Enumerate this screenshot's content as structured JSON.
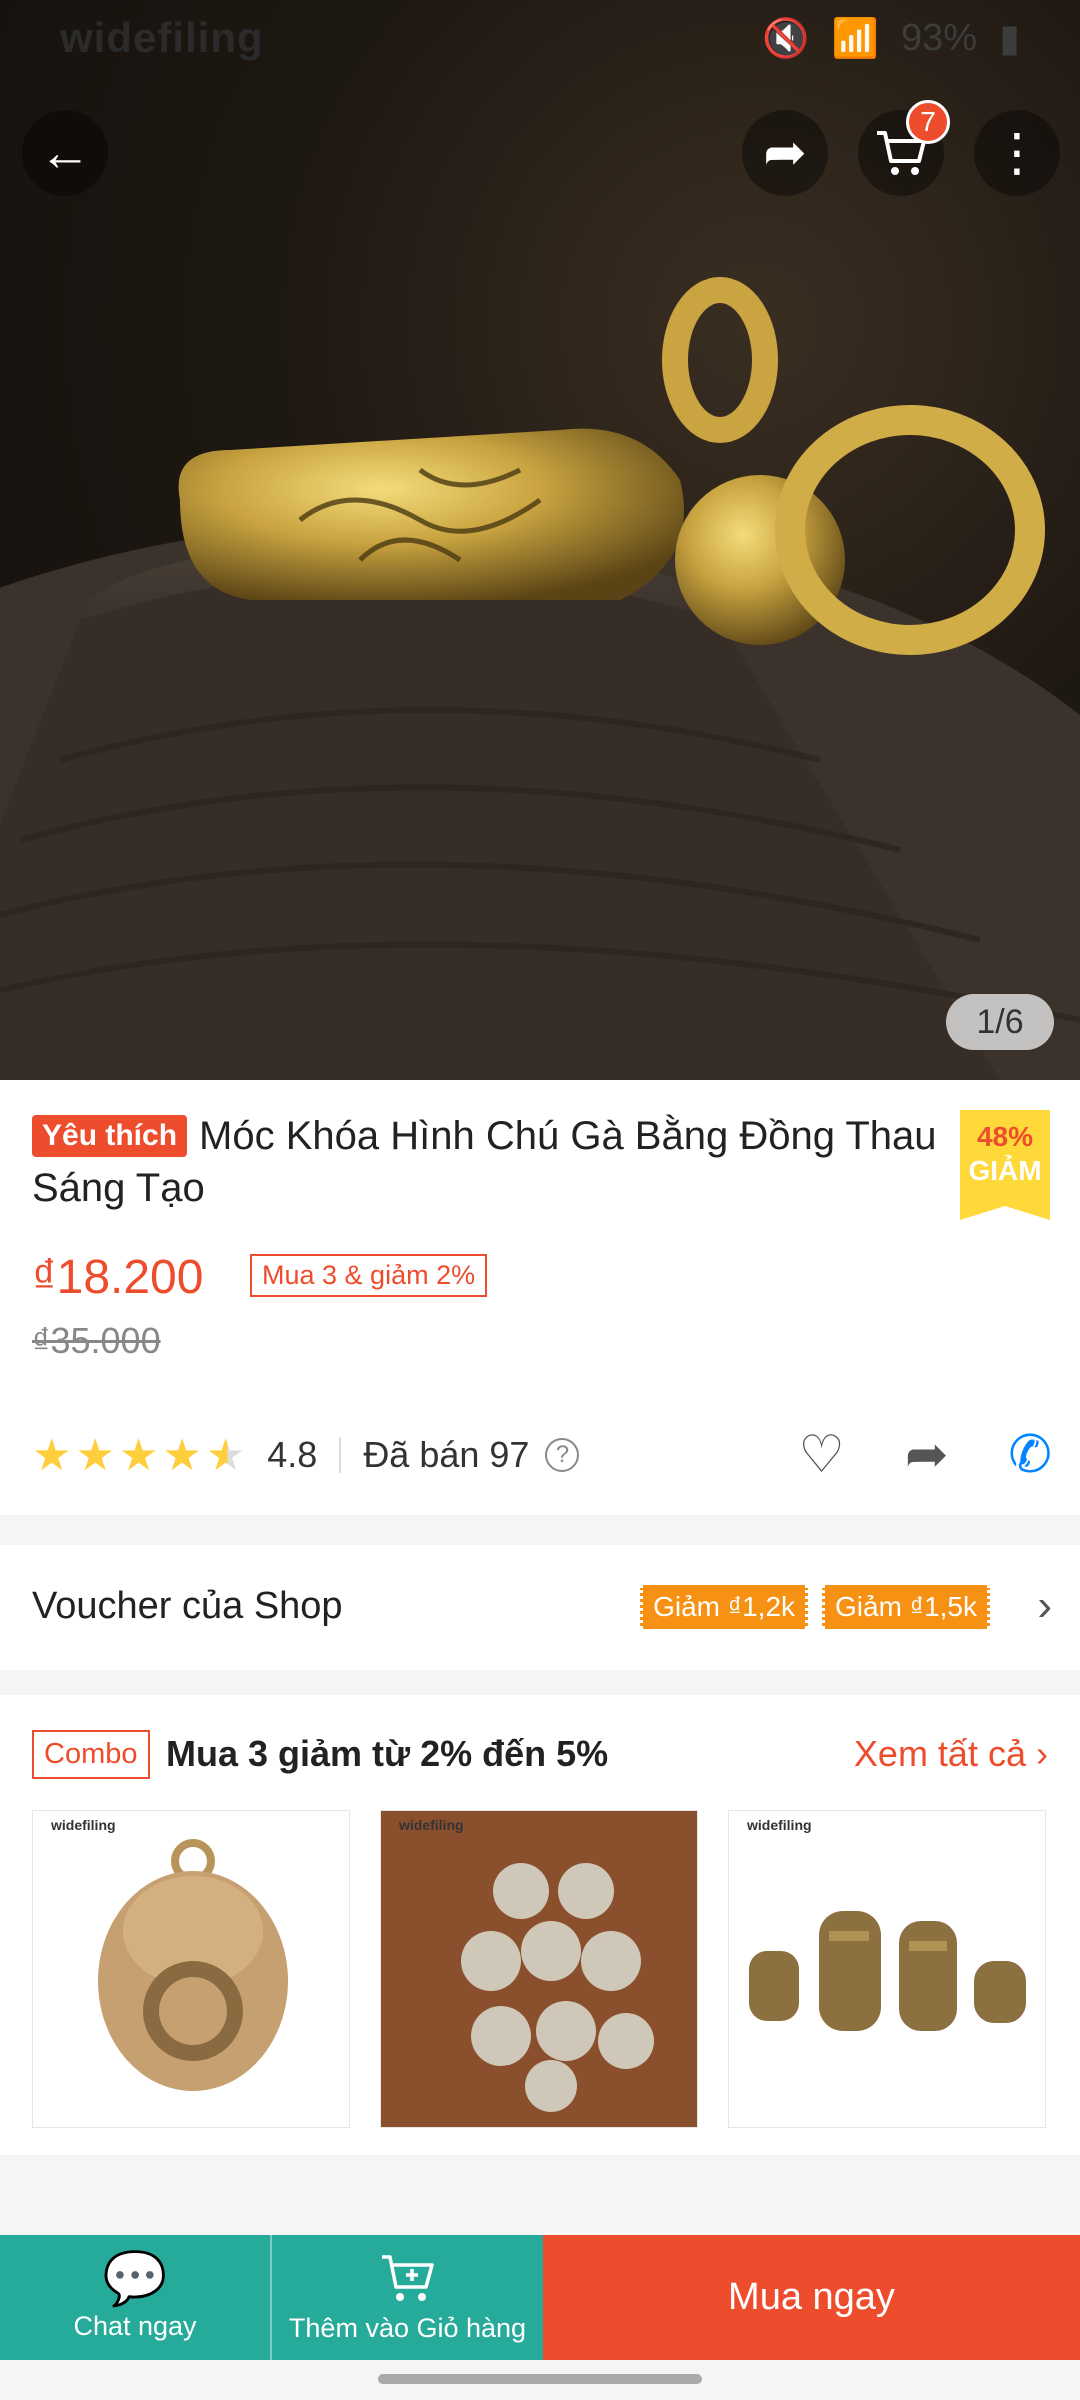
{
  "status_bar": {
    "brand": "widefiling",
    "battery": "93%"
  },
  "top_bar": {
    "cart_count": "7"
  },
  "gallery": {
    "counter": "1/6"
  },
  "product": {
    "badge": "Yêu thích",
    "title": "Móc Khóa Hình Chú Gà Bằng Đồng Thau Sáng Tạo",
    "discount_percent": "48%",
    "discount_label": "GIẢM",
    "price": "₫18.200",
    "promo": "Mua 3 & giảm 2%",
    "old_price": "₫35.000",
    "rating": "4.8",
    "sold": "Đã bán 97",
    "help": "?"
  },
  "voucher": {
    "label": "Voucher của Shop",
    "chips": [
      "Giảm ₫1,2k",
      "Giảm ₫1,5k"
    ]
  },
  "combo": {
    "tag": "Combo",
    "title": "Mua 3 giảm từ 2% đến 5%",
    "see_all": "Xem tất cả",
    "items": [
      {
        "watermark": "widefiling"
      },
      {
        "watermark": "widefiling"
      },
      {
        "watermark": "widefiling"
      }
    ]
  },
  "bottom_bar": {
    "chat": "Chat ngay",
    "add_to_cart": "Thêm vào Giỏ hàng",
    "buy_now": "Mua ngay"
  },
  "colors": {
    "accent": "#ee4d2d",
    "teal": "#26aa99",
    "star": "#ffce3d",
    "voucher": "#f69113"
  }
}
